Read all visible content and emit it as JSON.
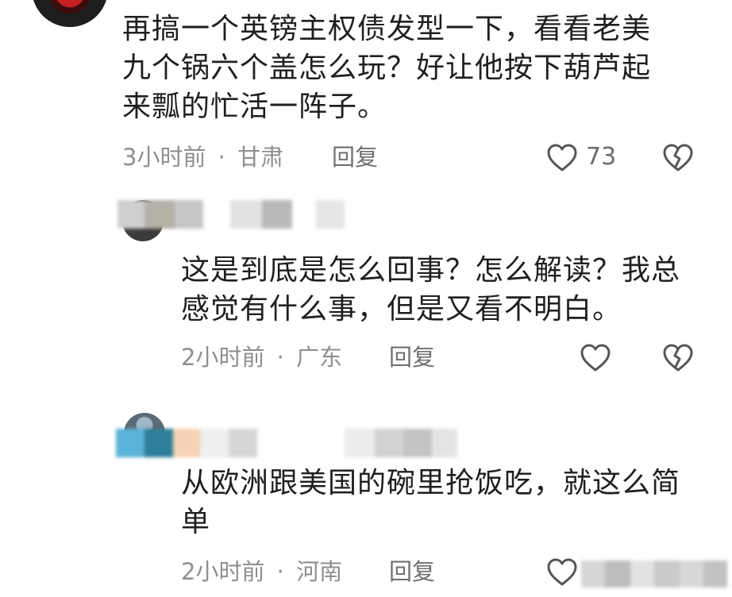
{
  "comments": [
    {
      "text": "再搞一个英镑主权债发型一下，看看老美九个锅六个盖怎么玩？好让他按下葫芦起来瓢的忙活一阵子。",
      "lines": [
        "再搞一个英镑主权债发型一下，看看老美",
        "九个锅六个盖怎么玩？好让他按下葫芦起",
        "来瓢的忙活一阵子。"
      ],
      "time": "3小时前",
      "separator": "·",
      "location": "甘肃",
      "reply_label": "回复",
      "likes": "73"
    },
    {
      "lines": [
        "这是到底是怎么回事？怎么解读？我总",
        "感觉有什么事，但是又看不明白。"
      ],
      "time": "2小时前",
      "separator": "·",
      "location": "广东",
      "reply_label": "回复"
    },
    {
      "lines": [
        "从欧洲跟美国的碗里抢饭吃，就这么简",
        "单"
      ],
      "time": "2小时前",
      "separator": "·",
      "location": "河南",
      "reply_label": "回复"
    }
  ],
  "icons": {
    "like": "heart-outline-icon",
    "dislike": "broken-heart-icon"
  },
  "colors": {
    "text": "#1f1f1f",
    "meta": "#8f8f8f",
    "icon": "#555555"
  }
}
